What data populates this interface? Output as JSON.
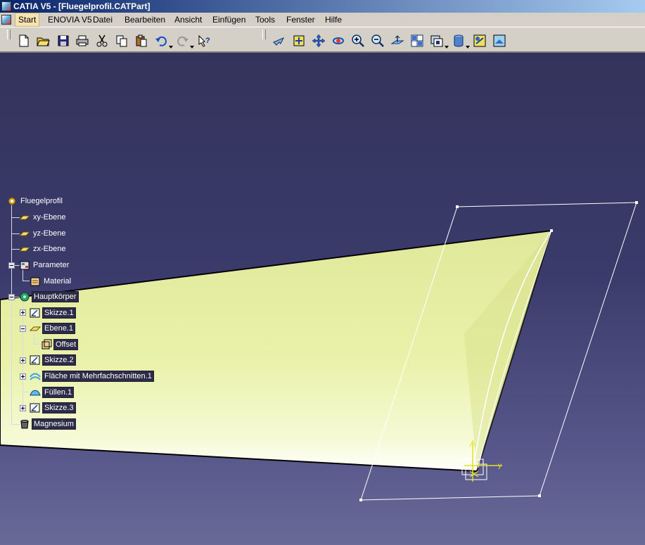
{
  "window": {
    "title": "CATIA V5 - [Fluegelprofil.CATPart]",
    "app_icon": "catia-logo-icon"
  },
  "menubar": {
    "items": [
      {
        "label": "Start",
        "active": true
      },
      {
        "label": "ENOVIA V5"
      },
      {
        "label": "Datei"
      },
      {
        "label": "Bearbeiten"
      },
      {
        "label": "Ansicht"
      },
      {
        "label": "Einfügen"
      },
      {
        "label": "Tools"
      },
      {
        "label": "Fenster"
      },
      {
        "label": "Hilfe"
      }
    ]
  },
  "toolbar": {
    "standard": [
      "new-file-icon",
      "open-folder-icon",
      "save-icon",
      "print-icon",
      "cut-icon",
      "copy-icon",
      "paste-icon",
      "undo-icon",
      "redo-icon",
      "whats-this-icon"
    ],
    "view": [
      "fly-mode-icon",
      "fit-all-icon",
      "pan-icon",
      "rotate-icon",
      "zoom-in-icon",
      "zoom-out-icon",
      "normal-view-icon",
      "multi-view-icon",
      "quick-view-icon",
      "view-mode-icon",
      "hide-show-icon",
      "swap-visible-space-icon"
    ]
  },
  "tree": {
    "nodes": [
      {
        "label": "Fluegelprofil",
        "icon": "part-icon",
        "style": "light"
      },
      {
        "label": "xy-Ebene",
        "icon": "plane-icon",
        "style": "light"
      },
      {
        "label": "yz-Ebene",
        "icon": "plane-icon",
        "style": "light"
      },
      {
        "label": "zx-Ebene",
        "icon": "plane-icon",
        "style": "light"
      },
      {
        "label": "Parameter",
        "icon": "parameters-icon",
        "style": "light"
      },
      {
        "label": "Material",
        "icon": "material-icon",
        "style": "light"
      },
      {
        "label": "Hauptkörper",
        "icon": "body-icon",
        "style": "boxed"
      },
      {
        "label": "Skizze.1",
        "icon": "sketch-icon",
        "style": "boxed"
      },
      {
        "label": "Ebene.1",
        "icon": "plane-icon",
        "style": "boxed"
      },
      {
        "label": "Offset",
        "icon": "offset-icon",
        "style": "boxed"
      },
      {
        "label": "Skizze.2",
        "icon": "sketch-icon",
        "style": "boxed"
      },
      {
        "label": "Fläche mit Mehrfachschnitten.1",
        "icon": "multi-section-surface-icon",
        "style": "boxed"
      },
      {
        "label": "Füllen.1",
        "icon": "fill-icon",
        "style": "boxed"
      },
      {
        "label": "Skizze.3",
        "icon": "sketch-icon",
        "style": "boxed"
      },
      {
        "label": "Magnesium",
        "icon": "material-bucket-icon",
        "style": "boxed"
      }
    ]
  },
  "viewport": {
    "background_top": "#33335c",
    "background_bottom": "#6a6a98",
    "surface_color": "#eef5b0",
    "compass_axis_label": "y"
  }
}
